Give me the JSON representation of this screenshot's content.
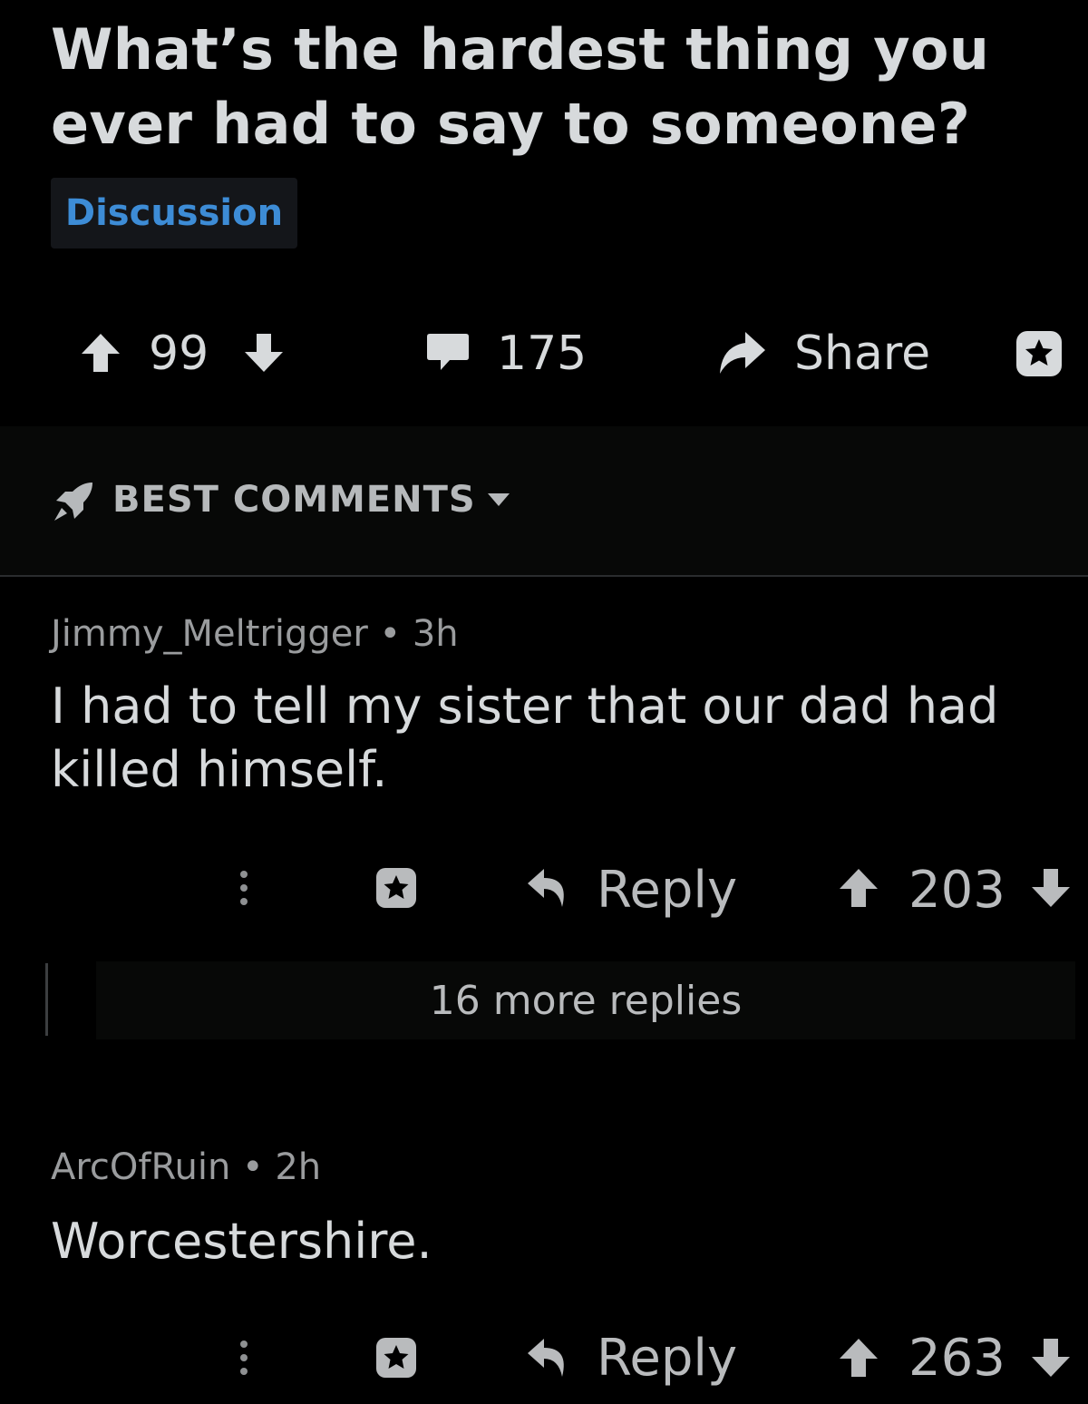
{
  "post": {
    "title_line1": "What’s the hardest thing you",
    "title_line2": "ever had to say to someone?",
    "flair": "Discussion",
    "score": "99",
    "comments": "175",
    "share_label": "Share"
  },
  "sort": {
    "label": "BEST COMMENTS"
  },
  "comments": [
    {
      "author": "Jimmy_Meltrigger",
      "age": "3h",
      "body_line1": "I had to tell my sister that our dad had",
      "body_line2": "killed himself.",
      "reply_label": "Reply",
      "score": "203",
      "more_replies": "16 more replies"
    },
    {
      "author": "ArcOfRuin",
      "age": "2h",
      "body_line1": "Worcestershire.",
      "reply_label": "Reply",
      "score": "263"
    }
  ],
  "colors": {
    "background": "#000000",
    "text": "#d7dadc",
    "flair": "#3d8cd6"
  }
}
